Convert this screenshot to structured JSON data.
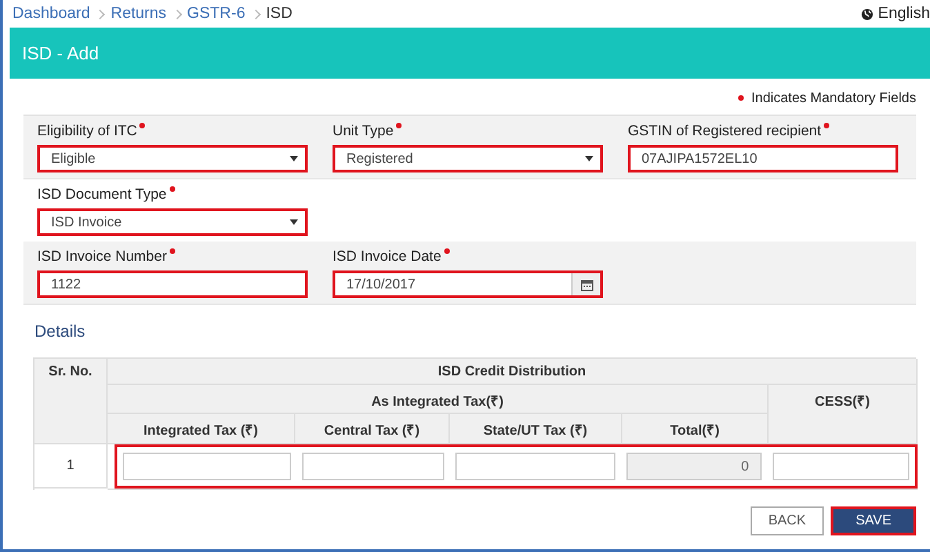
{
  "breadcrumb": [
    {
      "label": "Dashboard",
      "current": false
    },
    {
      "label": "Returns",
      "current": false
    },
    {
      "label": "GSTR-6",
      "current": false
    },
    {
      "label": "ISD",
      "current": true
    }
  ],
  "language": "English",
  "title": "ISD - Add",
  "mandatory_note": "Indicates Mandatory Fields",
  "field_rows": [
    {
      "shaded": true,
      "fields": [
        {
          "label": "Eligibility of ITC",
          "required": true,
          "kind": "select",
          "value": "Eligible",
          "highlighted": true
        },
        {
          "label": "Unit Type",
          "required": true,
          "kind": "select",
          "value": "Registered",
          "highlighted": true
        },
        {
          "label": "GSTIN of Registered recipient",
          "required": true,
          "kind": "text",
          "value": "07AJIPA1572EL10",
          "highlighted": true
        }
      ]
    },
    {
      "shaded": false,
      "fields": [
        {
          "label": "ISD Document Type",
          "required": true,
          "kind": "select",
          "value": "ISD Invoice",
          "highlighted": true
        }
      ]
    },
    {
      "shaded": true,
      "fields": [
        {
          "label": "ISD Invoice Number",
          "required": true,
          "kind": "text",
          "value": "1122",
          "highlighted": true
        },
        {
          "label": "ISD Invoice Date",
          "required": true,
          "kind": "date",
          "value": "17/10/2017",
          "highlighted": true
        }
      ]
    }
  ],
  "details_heading": "Details",
  "table": {
    "sr_header": "Sr. No.",
    "group_header": "ISD Credit Distribution",
    "subgroup_header": "As Integrated Tax(₹)",
    "cess_header": "CESS(₹)",
    "columns": [
      "Integrated Tax (₹)",
      "Central Tax (₹)",
      "State/UT Tax (₹)",
      "Total(₹)"
    ],
    "rows": [
      {
        "sr": "1",
        "highlighted": true,
        "cells": [
          {
            "disabled": false
          },
          {
            "disabled": false
          },
          {
            "disabled": false
          },
          {
            "value": "0",
            "disabled": true
          },
          {
            "disabled": false
          }
        ]
      }
    ]
  },
  "buttons": [
    {
      "label": "BACK",
      "kind": "secondary",
      "highlighted": false
    },
    {
      "label": "SAVE",
      "kind": "primary",
      "highlighted": true
    }
  ]
}
